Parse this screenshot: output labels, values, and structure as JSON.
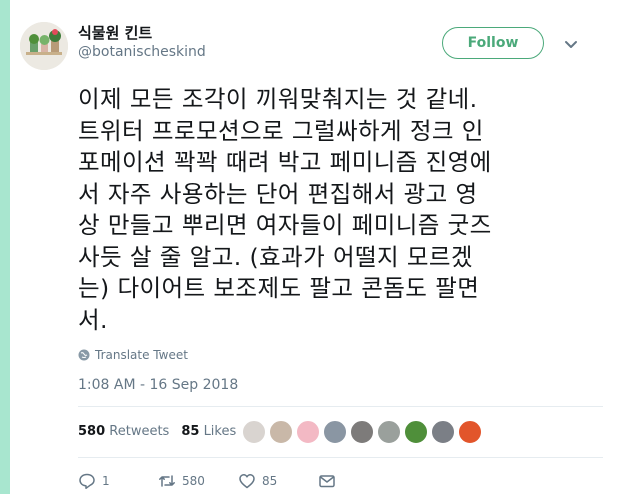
{
  "author": {
    "display_name": "식물원 킨트",
    "handle": "@botanischeskind"
  },
  "follow_label": "Follow",
  "tweet": {
    "text": "이제 모든 조각이 끼워맞춰지는 것 같네.\n트위터 프로모션으로 그럴싸하게 정크 인\n포메이션 꽉꽉 때려 박고 페미니즘 진영에\n서 자주 사용하는 단어 편집해서 광고 영\n상 만들고 뿌리면 여자들이 페미니즘 굿즈\n사듯 살 줄 알고. (효과가 어떨지 모르겠\n는) 다이어트 보조제도 팔고 콘돔도 팔면\n서."
  },
  "translate_label": "Translate Tweet",
  "timestamp": "1:08 AM - 16 Sep 2018",
  "stats": {
    "retweets_count": "580",
    "retweets_label": "Retweets",
    "likes_count": "85",
    "likes_label": "Likes"
  },
  "liker_avatars": [
    "#d9d4d0",
    "#c9b8a8",
    "#f3b9c4",
    "#8a96a3",
    "#7d7b7a",
    "#9aa09c",
    "#4f8f3a",
    "#7b7f86",
    "#e2552b"
  ],
  "actions": {
    "replies": "1",
    "retweets": "580",
    "likes": "85"
  },
  "colors": {
    "accent": "#4ba97a",
    "rail": "#a8e6cf",
    "muted": "#657786"
  }
}
